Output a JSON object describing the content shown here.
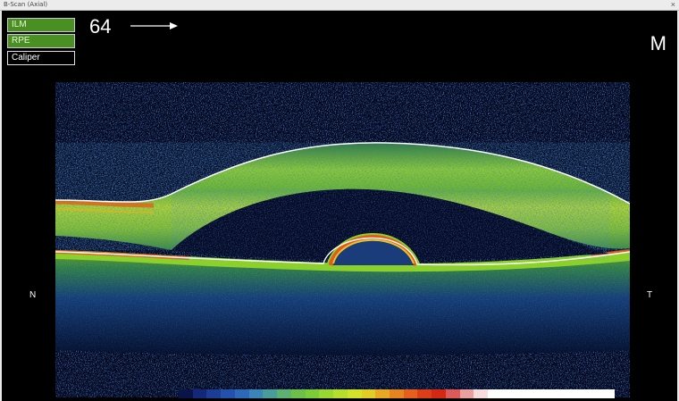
{
  "window": {
    "title": "B-Scan (Axial)",
    "close_glyph": "×"
  },
  "layers": {
    "ilm": {
      "label": "ILM",
      "state": "on"
    },
    "rpe": {
      "label": "RPE",
      "state": "on"
    },
    "caliper": {
      "label": "Caliper",
      "state": "off"
    }
  },
  "scan": {
    "number": "64",
    "direction": "arrow-right-icon"
  },
  "eye": {
    "label": "M"
  },
  "orientation": {
    "left": "N",
    "right": "T"
  },
  "colors": {
    "layer_on": "#4a8f22",
    "background": "#000000",
    "scan_background": "#02061a"
  },
  "colorbar": {
    "stops": [
      "#0a1448",
      "#14287a",
      "#1c3c96",
      "#2450ae",
      "#2c6ab8",
      "#3a84b8",
      "#4a9c9a",
      "#5cb070",
      "#6cc04a",
      "#7ccc38",
      "#98d630",
      "#b6de2c",
      "#d2e228",
      "#e2cc26",
      "#e8a824",
      "#e88420",
      "#e4601c",
      "#dc3e18",
      "#d42814",
      "#dc5a5a",
      "#eaa0a0",
      "#f6dcdc",
      "#ffffff",
      "#ffffff",
      "#ffffff",
      "#ffffff",
      "#ffffff",
      "#ffffff",
      "#ffffff",
      "#ffffff",
      "#ffffff"
    ]
  }
}
